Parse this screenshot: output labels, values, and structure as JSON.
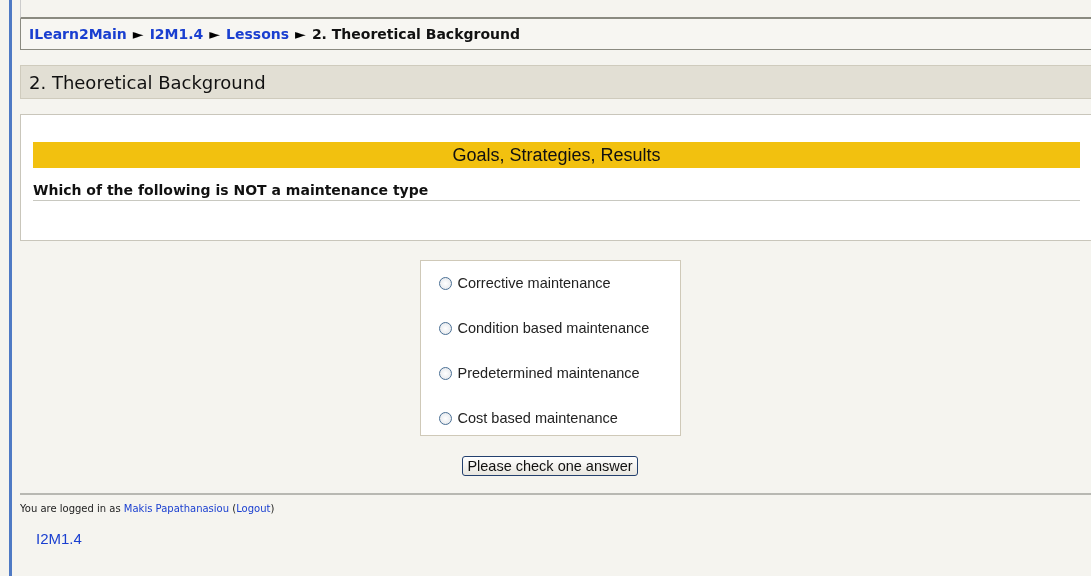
{
  "breadcrumb": [
    {
      "label": "ILearn2Main",
      "kind": "link"
    },
    {
      "label": "►",
      "kind": "separator"
    },
    {
      "label": "I2M1.4",
      "kind": "link"
    },
    {
      "label": "►",
      "kind": "separator"
    },
    {
      "label": "Lessons",
      "kind": "link"
    },
    {
      "label": "►",
      "kind": "separator"
    },
    {
      "label": "2. Theoretical Background",
      "kind": "current"
    }
  ],
  "page_title": "2. Theoretical Background",
  "banner": "Goals, Strategies, Results",
  "question": "Which of the following is NOT a maintenance type",
  "answers": [
    {
      "label": "Corrective maintenance",
      "selected": false
    },
    {
      "label": "Condition based maintenance",
      "selected": false
    },
    {
      "label": "Predetermined maintenance",
      "selected": false
    },
    {
      "label": "Cost based maintenance",
      "selected": false
    }
  ],
  "submit_button": "Please check one answer",
  "footer": {
    "prefix": "You are logged in as",
    "user": "Makis Papathanasiou",
    "open": "(",
    "logout": "Logout",
    "close": ")"
  },
  "course_link": "I2M1.4"
}
